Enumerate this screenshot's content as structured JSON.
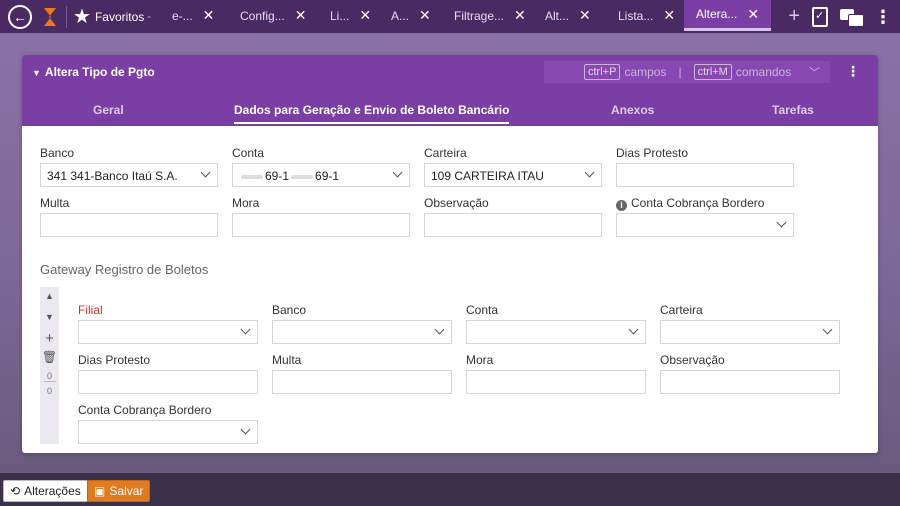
{
  "topbar": {
    "favorites_label": "Favoritos",
    "favorites_caret": "-",
    "tabs": [
      {
        "label": "e-..."
      },
      {
        "label": "Config..."
      },
      {
        "label": "Li..."
      },
      {
        "label": "A..."
      },
      {
        "label": "Filtrage..."
      },
      {
        "label": "Alt..."
      },
      {
        "label": "Lista..."
      },
      {
        "label": "Altera..."
      }
    ],
    "close_glyph": "✕"
  },
  "panel": {
    "title": "Altera Tipo de Pgto",
    "shortcut_fields_key": "ctrl+P",
    "shortcut_fields_label": "campos",
    "shortcut_divider": "|",
    "shortcut_commands_key": "ctrl+M",
    "shortcut_commands_label": "comandos",
    "tabs": [
      {
        "label": "Geral"
      },
      {
        "label": "Dados para Geração e Envio de Boleto Bancário"
      },
      {
        "label": "Anexos"
      },
      {
        "label": "Tarefas"
      }
    ]
  },
  "form": {
    "banco_label": "Banco",
    "banco_value": "341 341-Banco Itaú S.A.",
    "conta_label": "Conta",
    "conta_value_a": "69-1",
    "conta_value_b": "69-1",
    "carteira_label": "Carteira",
    "carteira_value": "109 CARTEIRA ITAU",
    "dias_protesto_label": "Dias Protesto",
    "dias_protesto_value": "",
    "multa_label": "Multa",
    "multa_value": "",
    "mora_label": "Mora",
    "mora_value": "",
    "observacao_label": "Observação",
    "observacao_value": "",
    "conta_cobranca_label": "Conta Cobrança Bordero",
    "conta_cobranca_value": ""
  },
  "gateway": {
    "title": "Gateway Registro de Boletos",
    "side_counts": [
      "0",
      "0"
    ],
    "filial_label": "Filial",
    "banco_label": "Banco",
    "conta_label": "Conta",
    "carteira_label": "Carteira",
    "dias_protesto_label": "Dias Protesto",
    "multa_label": "Multa",
    "mora_label": "Mora",
    "observacao_label": "Observação",
    "conta_cobranca_label": "Conta Cobrança Bordero"
  },
  "bottombar": {
    "alteracoes_label": "Alterações",
    "salvar_label": "Salvar"
  }
}
